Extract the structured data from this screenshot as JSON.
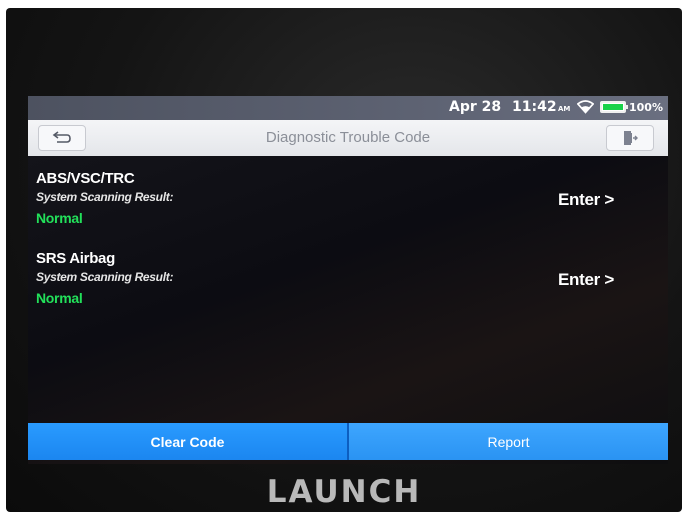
{
  "status_bar": {
    "date": "Apr 28",
    "time": "11:42",
    "ampm": "AM",
    "battery": "100%",
    "battery_level": 1.0,
    "wifi_icon": "wifi-icon"
  },
  "header": {
    "title": "Diagnostic Trouble Code",
    "back_icon": "back-arrow-icon",
    "exit_icon": "exit-door-icon"
  },
  "modules": [
    {
      "name": "ABS/VSC/TRC",
      "label": "System Scanning Result:",
      "status": "Normal",
      "enter": "Enter >"
    },
    {
      "name": "SRS Airbag",
      "label": "System Scanning Result:",
      "status": "Normal",
      "enter": "Enter >"
    }
  ],
  "buttons": {
    "clear_code": "Clear Code",
    "report": "Report"
  },
  "brand": "LAUNCH",
  "colors": {
    "status_normal": "#22e05a",
    "button_blue": "#1b86f0",
    "battery_green": "#19d24a"
  }
}
